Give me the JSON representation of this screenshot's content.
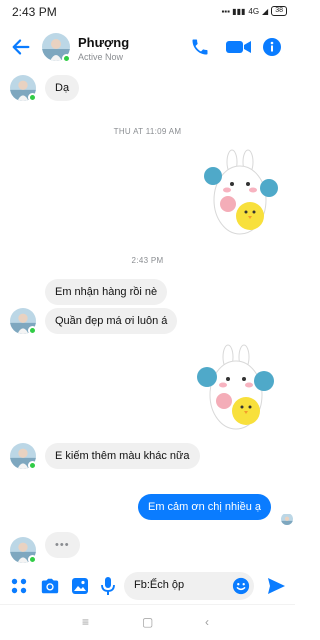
{
  "status_bar": {
    "time": "2:43 PM",
    "network": "4G",
    "battery": "38"
  },
  "header": {
    "contact_name": "Phượng",
    "contact_status": "Active Now"
  },
  "conversation": {
    "msg_1": "Dạ",
    "timestamp_1": "THU AT 11:09 AM",
    "timestamp_2": "2:43 PM",
    "msg_2": "Em nhận hàng rồi nè",
    "msg_3": "Quần đẹp má ơi luôn á",
    "msg_4": "E kiếm thêm màu khác nữa",
    "msg_out_1": "Em cảm ơn chị nhiều ạ",
    "typing": "•••"
  },
  "composer": {
    "input_value": "Fb:Ếch ộp"
  },
  "colors": {
    "accent": "#0a7cff",
    "online": "#31cc46",
    "incoming_bubble": "#f0f0f0"
  },
  "icons": [
    "back-arrow-icon",
    "phone-icon",
    "video-icon",
    "info-icon",
    "apps-icon",
    "camera-icon",
    "gallery-icon",
    "microphone-icon",
    "emoji-icon",
    "send-icon"
  ]
}
